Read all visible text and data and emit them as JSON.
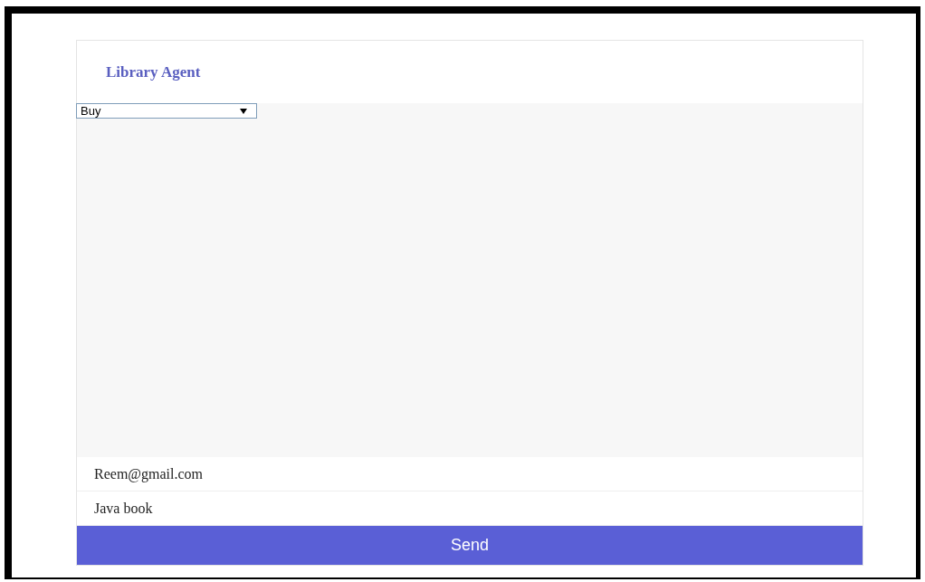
{
  "title": "Library Agent",
  "dropdown": {
    "value": "Buy"
  },
  "fields": [
    {
      "value": "Reem@gmail.com"
    },
    {
      "value": "Java book"
    }
  ],
  "send_button": "Send"
}
